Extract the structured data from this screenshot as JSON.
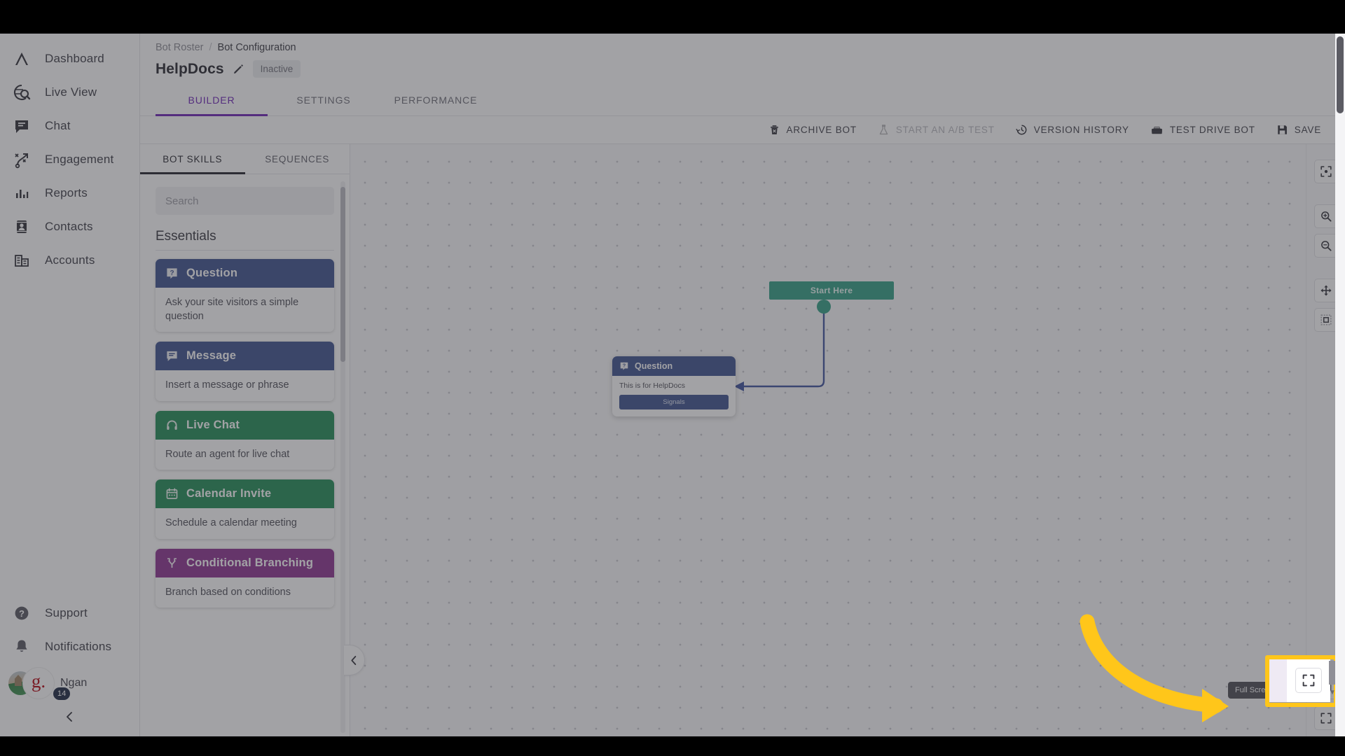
{
  "sidebar": {
    "items": [
      {
        "label": "Dashboard",
        "icon": "logo-peak-icon"
      },
      {
        "label": "Live View",
        "icon": "live-view-globe-icon"
      },
      {
        "label": "Chat",
        "icon": "chat-bubble-icon"
      },
      {
        "label": "Engagement",
        "icon": "engagement-path-icon"
      },
      {
        "label": "Reports",
        "icon": "bar-chart-icon"
      },
      {
        "label": "Contacts",
        "icon": "contact-card-icon"
      },
      {
        "label": "Accounts",
        "icon": "building-icon"
      }
    ],
    "bottom_items": [
      {
        "label": "Support",
        "icon": "help-circle-icon"
      },
      {
        "label": "Notifications",
        "icon": "bell-icon"
      }
    ],
    "user": {
      "name": "Ngan",
      "brand_initial": "g.",
      "notification_count": "14"
    },
    "collapse_icon": "chevron-left-icon"
  },
  "breadcrumb": {
    "parent": "Bot Roster",
    "separator": "/",
    "current": "Bot Configuration"
  },
  "header": {
    "bot_name": "HelpDocs",
    "edit_icon": "pencil-icon",
    "status": "Inactive"
  },
  "tabs": [
    {
      "label": "BUILDER",
      "active": true
    },
    {
      "label": "SETTINGS",
      "active": false
    },
    {
      "label": "PERFORMANCE",
      "active": false
    }
  ],
  "toolbar": [
    {
      "label": "ARCHIVE BOT",
      "icon": "trash-icon",
      "disabled": false
    },
    {
      "label": "START AN A/B TEST",
      "icon": "flask-icon",
      "disabled": true
    },
    {
      "label": "VERSION HISTORY",
      "icon": "history-clock-icon",
      "disabled": false
    },
    {
      "label": "TEST DRIVE BOT",
      "icon": "car-icon",
      "disabled": false
    },
    {
      "label": "SAVE",
      "icon": "floppy-disk-icon",
      "disabled": false
    }
  ],
  "skill_panel": {
    "tabs": [
      {
        "label": "BOT SKILLS",
        "active": true
      },
      {
        "label": "SEQUENCES",
        "active": false
      }
    ],
    "search_placeholder": "Search",
    "search_value": "",
    "group_title": "Essentials",
    "cards": [
      {
        "title": "Question",
        "desc": "Ask your site visitors a simple question",
        "color": "#3b4f8c",
        "icon": "question-badge-icon"
      },
      {
        "title": "Message",
        "desc": "Insert a message or phrase",
        "color": "#3b4f8c",
        "icon": "message-bubble-icon"
      },
      {
        "title": "Live Chat",
        "desc": "Route an agent for live chat",
        "color": "#1d8a53",
        "icon": "headset-icon"
      },
      {
        "title": "Calendar Invite",
        "desc": "Schedule a calendar meeting",
        "color": "#1d8a53",
        "icon": "calendar-icon"
      },
      {
        "title": "Conditional Branching",
        "desc": "Branch based on conditions",
        "color": "#8b2f8f",
        "icon": "branch-icon"
      }
    ]
  },
  "canvas": {
    "start_node": {
      "label": "Start Here",
      "color": "#2e9e83"
    },
    "question_node": {
      "title": "Question",
      "icon": "question-badge-icon",
      "text": "This is for HelpDocs",
      "button_label": "Signals",
      "color": "#3b4f8c"
    }
  },
  "canvas_rail": [
    {
      "icon": "focus-center-icon",
      "name": "recenter-button"
    },
    {
      "icon": "zoom-in-icon",
      "name": "zoom-in-button"
    },
    {
      "icon": "zoom-out-icon",
      "name": "zoom-out-button"
    },
    {
      "icon": "pan-move-icon",
      "name": "pan-button"
    },
    {
      "icon": "fit-selection-icon",
      "name": "fit-selection-button"
    }
  ],
  "canvas_rail_bottom": [
    {
      "icon": "keyboard-shortcuts-icon",
      "name": "keyboard-shortcuts-button"
    },
    {
      "icon": "fullscreen-icon",
      "name": "fullscreen-button"
    }
  ],
  "tooltip": {
    "text": "Full Screen"
  },
  "annotation": {
    "highlight_color": "#ffc61a",
    "arrow_color": "#ffc61a"
  }
}
